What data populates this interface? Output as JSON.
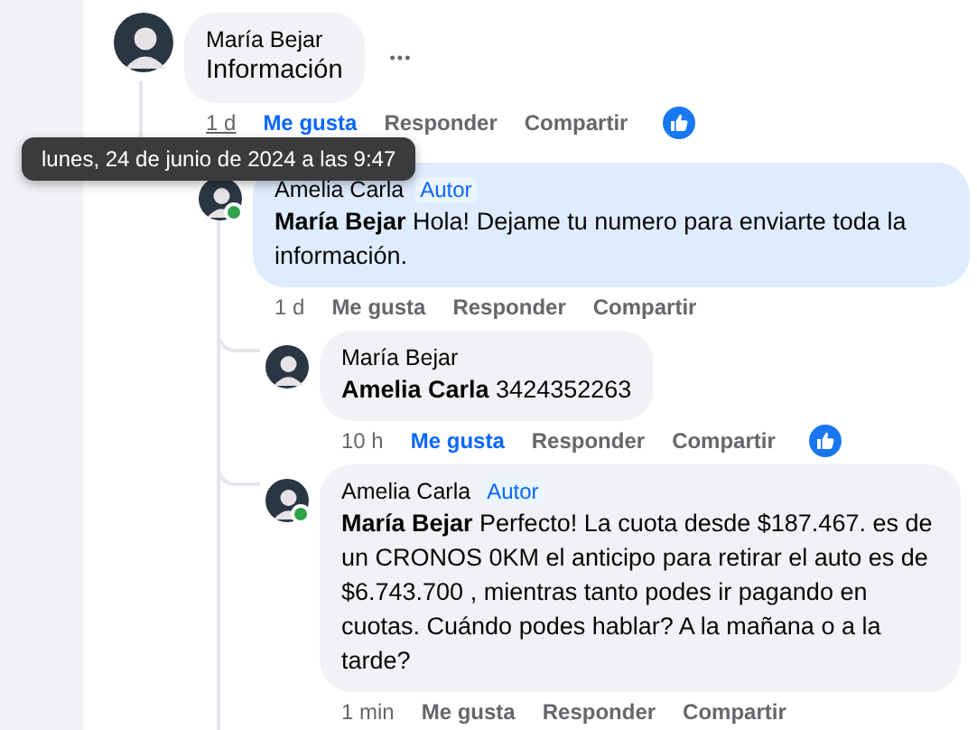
{
  "comments": [
    {
      "author": "María Bejar",
      "online": false,
      "text": "Información",
      "highlighted": false,
      "more_button": "•••",
      "time": "1 d",
      "time_hovered": true,
      "like_label": "Me gusta",
      "liked": true,
      "reply_label": "Responder",
      "share_label": "Compartir",
      "reaction": true
    },
    {
      "author": "Amelia Carla",
      "online": true,
      "badge": "Autor",
      "mention": "María Bejar",
      "text": "Hola! Dejame tu numero para enviarte toda la información.",
      "highlighted": true,
      "time": "1 d",
      "time_hovered": false,
      "like_label": "Me gusta",
      "liked": false,
      "reply_label": "Responder",
      "share_label": "Compartir",
      "reaction": false
    },
    {
      "author": "María Bejar",
      "online": false,
      "mention": "Amelia Carla",
      "text": "3424352263",
      "highlighted": false,
      "time": "10 h",
      "time_hovered": false,
      "like_label": "Me gusta",
      "liked": true,
      "reply_label": "Responder",
      "share_label": "Compartir",
      "reaction": true
    },
    {
      "author": "Amelia Carla",
      "online": true,
      "badge": "Autor",
      "mention": "María Bejar",
      "text": "Perfecto! La cuota desde $187.467. es de un CRONOS 0KM el anticipo para retirar el auto es de $6.743.700 , mientras tanto podes ir pagando en cuotas. Cuándo podes hablar? A la mañana o a la tarde?",
      "highlighted": false,
      "time": "1 min",
      "time_hovered": false,
      "like_label": "Me gusta",
      "liked": false,
      "reply_label": "Responder",
      "share_label": "Compartir",
      "reaction": false
    }
  ],
  "tooltip": {
    "text": "lunes, 24 de junio de 2024 a las 9:47"
  }
}
